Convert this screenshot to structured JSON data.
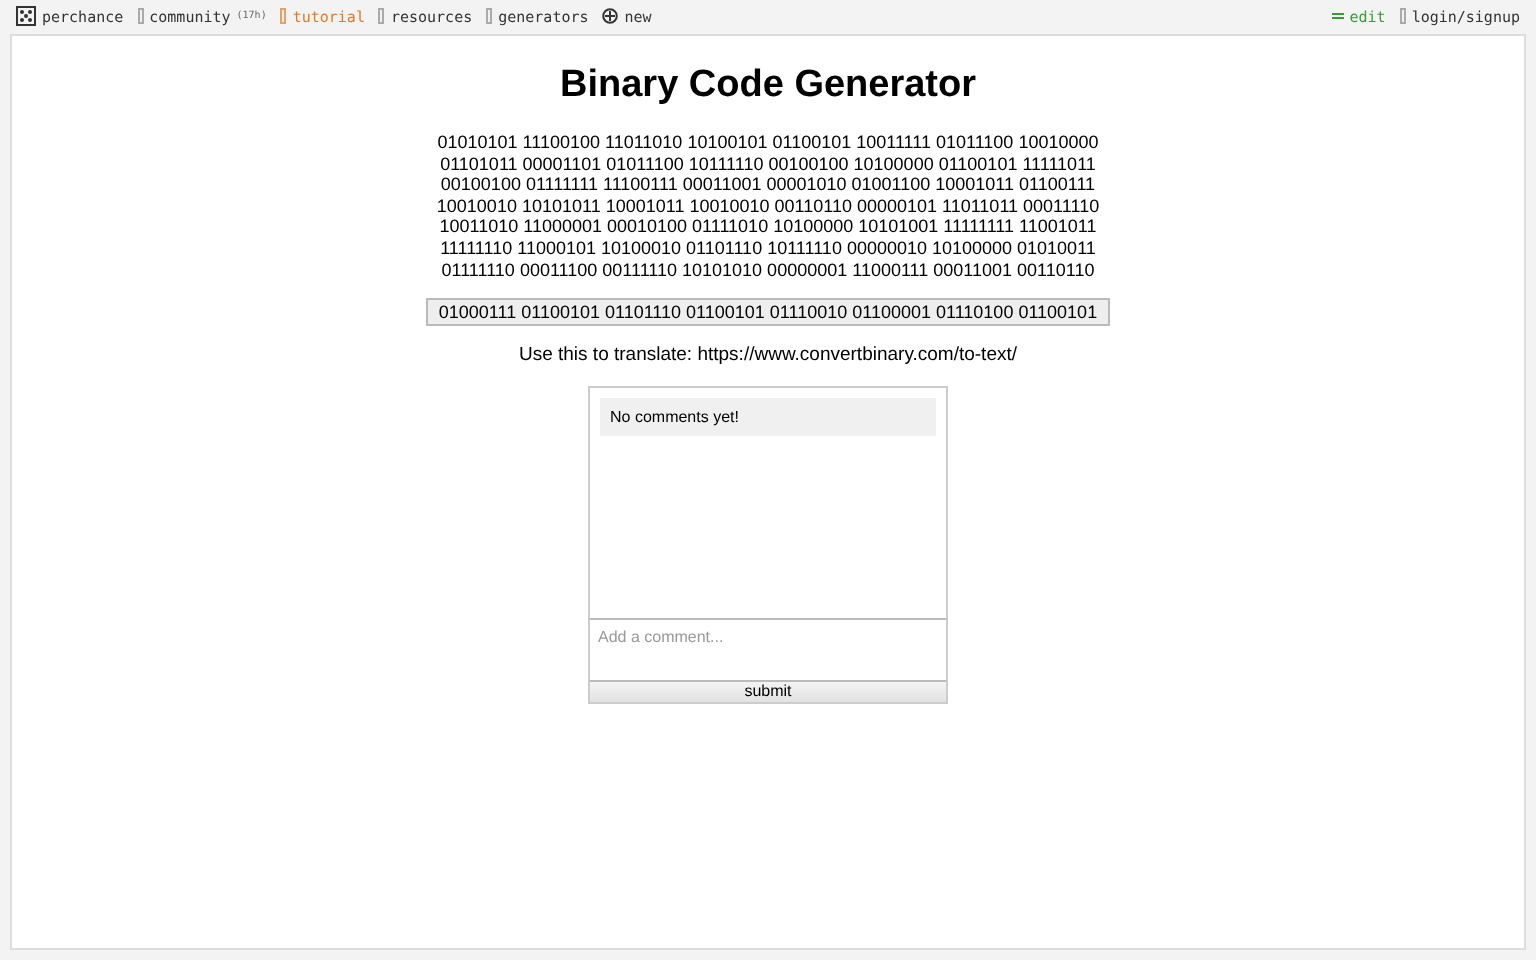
{
  "nav": {
    "brand": "perchance",
    "items": [
      {
        "label": "community",
        "badge": "(17h)",
        "selected": false
      },
      {
        "label": "tutorial",
        "selected": true
      },
      {
        "label": "resources",
        "selected": false
      },
      {
        "label": "generators",
        "selected": false
      }
    ],
    "new": "new",
    "edit": "edit",
    "login": "login/signup"
  },
  "title": "Binary Code Generator",
  "binary_lines": [
    "01010101 11100100 11011010 10100101 01100101 10011111 01011100 10010000",
    "01101011 00001101 01011100 10111110 00100100 10100000 01100101 11111011",
    "00100100 01111111 11100111 00011001 00001010 01001100 10001011 01100111",
    "10010010 10101011 10001011 10010010 00110110 00000101 11011011 00011110",
    "10011010 11000001 00010100 01111010 10100000 10101001 11111111 11001011",
    "11111110 11000101 10100010 01101110 10111110 00000010 10100000 01010011",
    "01111110 00011100 00111110 10101010 00000001 11000111 00011001 00110110"
  ],
  "answer_button": "01000111 01100101 01101110 01100101 01110010 01100001 01110100 01100101",
  "translate_note": "Use this to translate: https://www.convertbinary.com/to-text/",
  "comments": {
    "empty_message": "No comments yet!",
    "placeholder": "Add a comment...",
    "submit": "submit"
  }
}
